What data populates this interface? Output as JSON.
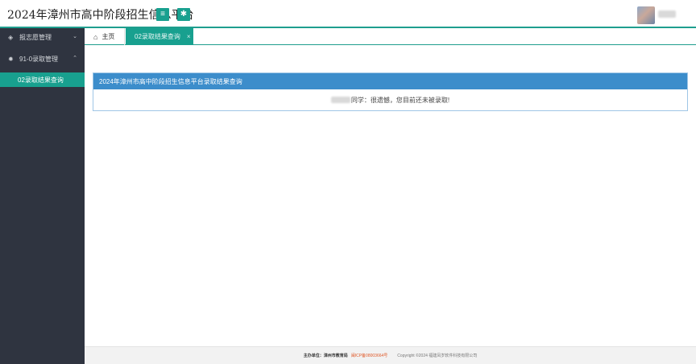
{
  "header": {
    "title": "2024年漳州市高中阶段招生信息平台",
    "menu_icon": "menu-icon",
    "settings_icon": "gear-icon"
  },
  "sidebar": {
    "items": [
      {
        "label": "报志愿管理",
        "icon": "layers-icon",
        "chevron": "⌄"
      },
      {
        "label": "91-0录取管理",
        "icon": "gear-icon",
        "chevron": "⌃"
      }
    ],
    "sub_items": [
      {
        "label": "02录取结果查询"
      }
    ]
  },
  "tabs": {
    "home_label": "主页",
    "active_label": "02录取结果查询",
    "close_symbol": "×"
  },
  "panel": {
    "title": "2024年漳州市高中阶段招生信息平台录取结果查询",
    "message": "同学：很遗憾，您目前还未被录取!"
  },
  "footer": {
    "organizer": "主办单位：漳州市教育局",
    "icp": "闽ICP备08003664号",
    "copyright": "Copyright ©2024 福建凤岁软件科技有限公司"
  },
  "colors": {
    "accent": "#18a08f",
    "sidebar_bg": "#2f3440",
    "panel_header": "#3c8dcb"
  }
}
